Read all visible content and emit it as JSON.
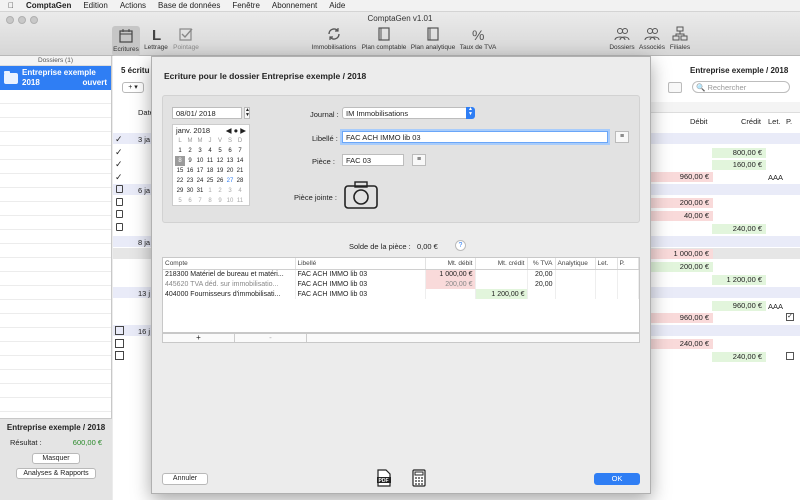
{
  "menubar": {
    "apple": "",
    "app": "ComptaGen",
    "items": [
      "Edition",
      "Actions",
      "Base de données",
      "Fenêtre",
      "Abonnement",
      "Aide"
    ]
  },
  "window": {
    "title": "ComptaGen v1.01"
  },
  "toolbar": {
    "left": [
      {
        "label": "Ecritures",
        "icon": "calendar-icon"
      },
      {
        "label": "Lettrage",
        "icon": "letter-l-icon"
      },
      {
        "label": "Pointage",
        "icon": "checkbox-icon"
      }
    ],
    "center": [
      {
        "label": "Immobilisations",
        "icon": "cycle-icon"
      },
      {
        "label": "Plan comptable",
        "icon": "book-icon"
      },
      {
        "label": "Plan analytique",
        "icon": "book-icon"
      },
      {
        "label": "Taux de TVA",
        "icon": "percent-icon"
      }
    ],
    "right": [
      {
        "label": "Dossiers",
        "icon": "people-icon"
      },
      {
        "label": "Associés",
        "icon": "people-icon"
      },
      {
        "label": "Filiales",
        "icon": "org-icon"
      }
    ]
  },
  "sidebar": {
    "header": "Dossiers (1)",
    "dossier": {
      "name": "Entreprise exemple",
      "year": "2018",
      "status": "ouvert"
    },
    "footer": {
      "title": "Entreprise exemple / 2018",
      "result_label": "Résultat :",
      "result_value": "600,00 €",
      "hide_label": "Masquer",
      "reports_label": "Analyses & Rapports"
    }
  },
  "list": {
    "count_label": "5 écritu",
    "add_label": "+",
    "company": "Entreprise exemple / 2018",
    "search_placeholder": "Rechercher",
    "headers": {
      "date": "Date",
      "debit": "Débit",
      "credit": "Crédit",
      "let": "Let.",
      "p": "P."
    },
    "dates": [
      "3 ja",
      "6 ja",
      "8 ja",
      "13 j",
      "16 j"
    ],
    "debits": [
      "960,00 €",
      "200,00 €",
      "40,00 €",
      "1 000,00 €",
      "960,00 €",
      "240,00 €"
    ],
    "credits": [
      "800,00 €",
      "160,00 €",
      "240,00 €",
      "200,00 €",
      "1 200,00 €",
      "960,00 €",
      "240,00 €"
    ],
    "letters": [
      "AAA",
      "AAA"
    ]
  },
  "sheet": {
    "title": "Ecriture pour le dossier Entreprise exemple / 2018",
    "date": "08/01/ 2018",
    "calendar": {
      "month": "janv. 2018",
      "days": [
        "L",
        "M",
        "M",
        "J",
        "V",
        "S",
        "D"
      ],
      "weeks": [
        [
          "1",
          "2",
          "3",
          "4",
          "5",
          "6",
          "7"
        ],
        [
          "8",
          "9",
          "10",
          "11",
          "12",
          "13",
          "14"
        ],
        [
          "15",
          "16",
          "17",
          "18",
          "19",
          "20",
          "21"
        ],
        [
          "22",
          "23",
          "24",
          "25",
          "26",
          "27",
          "28"
        ],
        [
          "29",
          "30",
          "31",
          "1",
          "2",
          "3",
          "4"
        ],
        [
          "5",
          "6",
          "7",
          "8",
          "9",
          "10",
          "11"
        ]
      ]
    },
    "journal_label": "Journal :",
    "journal_value": "IM Immobilisations",
    "libelle_label": "Libellé :",
    "libelle_value": "FAC ACH IMMO lib 03",
    "piece_label": "Pièce :",
    "piece_value": "FAC 03",
    "attach_label": "Pièce jointe :",
    "balance_label": "Solde de la pièce :",
    "balance_value": "0,00 €",
    "table": {
      "headers": [
        "Compte",
        "Libellé",
        "Mt. débit",
        "Mt. crédit",
        "% TVA",
        "Analytique",
        "Let.",
        "P."
      ],
      "rows": [
        {
          "compte": "218300 Matériel de bureau et matéri...",
          "libelle": "FAC ACH IMMO lib 03",
          "debit": "1 000,00 €",
          "credit": "",
          "tva": "20,00"
        },
        {
          "compte": "445620 TVA déd. sur immobilisatio...",
          "libelle": "FAC ACH IMMO lib 03",
          "debit": "200,00 €",
          "credit": "",
          "tva": "20,00"
        },
        {
          "compte": "404000 Fournisseurs d'immobilisati...",
          "libelle": "FAC ACH IMMO lib 03",
          "debit": "",
          "credit": "1 200,00 €",
          "tva": ""
        }
      ]
    },
    "add": "+",
    "remove": "-",
    "cancel_label": "Annuler",
    "ok_label": "OK"
  },
  "colors": {
    "accent": "#2f7ef4",
    "debit_bg": "#f9dada",
    "credit_bg": "#e2f5dc"
  }
}
